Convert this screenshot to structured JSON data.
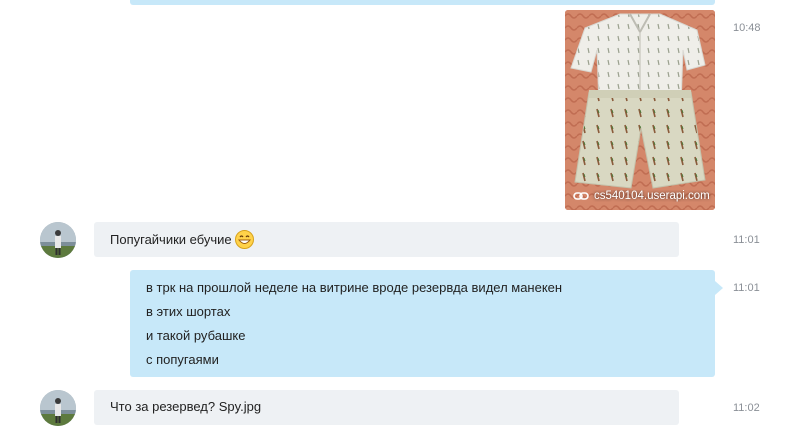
{
  "messages": [
    {
      "type": "image",
      "time": "10:48",
      "link": "cs540104.userapi.com"
    },
    {
      "type": "incoming",
      "time": "11:01",
      "text": "Попугайчики ебучие"
    },
    {
      "type": "outgoing",
      "time": "11:01",
      "lines": [
        "в трк на прошлой неделе на витрине вроде резервда видел манекен",
        "в этих шортах",
        "и такой рубашке",
        "с попугаями"
      ]
    },
    {
      "type": "incoming",
      "time": "11:02",
      "text": "Что за резервед? Spy.jpg"
    }
  ],
  "icons": {
    "link": "link-icon",
    "emoji": "grinning-face-icon",
    "avatar": "contact-avatar"
  },
  "colors": {
    "outgoing_bubble": "#c7e8f9",
    "incoming_bubble": "#eef1f4",
    "timestamp": "#8a8f96"
  }
}
